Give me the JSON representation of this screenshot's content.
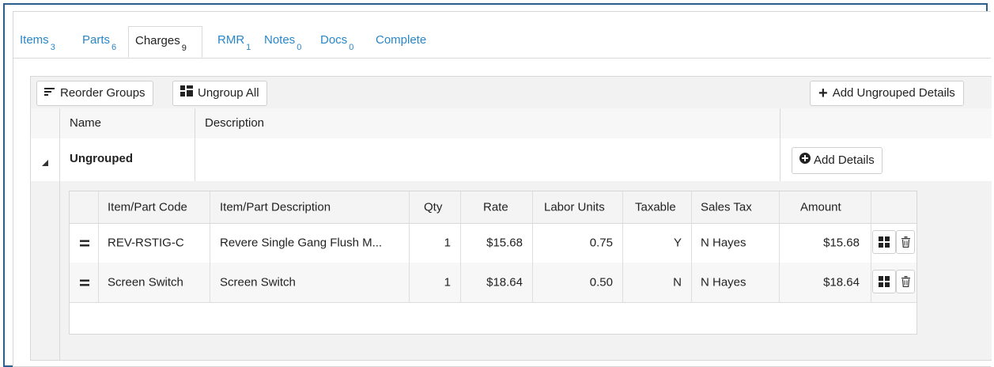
{
  "tabs": [
    {
      "label": "Items",
      "count": "3"
    },
    {
      "label": "Parts",
      "count": "6"
    },
    {
      "label": "Charges",
      "count": "9"
    },
    {
      "label": "RMR",
      "count": "1"
    },
    {
      "label": "Notes",
      "count": "0"
    },
    {
      "label": "Docs",
      "count": "0"
    },
    {
      "label": "Complete",
      "count": ""
    }
  ],
  "active_tab": "Charges",
  "toolbar": {
    "reorder_label": "Reorder Groups",
    "ungroup_label": "Ungroup All",
    "add_ungrouped_label": "Add Ungrouped Details"
  },
  "group_table": {
    "headers": {
      "name": "Name",
      "description": "Description"
    },
    "group": {
      "name": "Ungrouped",
      "add_details_label": "Add Details"
    }
  },
  "detail_table": {
    "headers": [
      "Item/Part Code",
      "Item/Part Description",
      "Qty",
      "Rate",
      "Labor Units",
      "Taxable",
      "Sales Tax",
      "Amount"
    ],
    "rows": [
      [
        "REV-RSTIG-C",
        "Revere Single Gang Flush M...",
        "1",
        "$15.68",
        "0.75",
        "Y",
        "N Hayes",
        "$15.68"
      ],
      [
        "Screen Switch",
        "Screen Switch",
        "1",
        "$18.64",
        "0.50",
        "N",
        "N Hayes",
        "$18.64"
      ]
    ]
  },
  "colors": {
    "accent": "#2a86c8",
    "border": "#2b5f8f"
  }
}
